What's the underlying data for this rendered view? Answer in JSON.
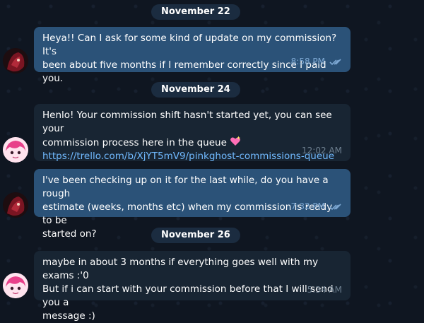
{
  "dates": {
    "d1": "November 22",
    "d2": "November 24",
    "d3": "November 26"
  },
  "messages": [
    {
      "side": "out",
      "text_line1": "Heya!! Can I ask for some kind of update on my commission? It's",
      "text_line2": "been about five months if I remember correctly since I paid you.",
      "time": "8:58 PM"
    },
    {
      "side": "in",
      "text_line1": "Henlo! Your commission shift hasn't started yet, you can see your",
      "text_line2": "commission process here in the queue",
      "link": "https://trello.com/b/XjYT5mV9/pinkghost-commissions-queue",
      "time": "12:02 AM"
    },
    {
      "side": "out",
      "text_line1": "I've been checking up on it for the last while, do you have a rough",
      "text_line2": "estimate (weeks, months etc) when my commission is ready to be",
      "text_line3": "started on?",
      "time": "7:32 PM"
    },
    {
      "side": "in",
      "text_line1": "maybe in about 3 months if everything goes well with my exams :'0",
      "text_line2": "But if i can start with your commission before that I will send you a",
      "text_line3": "message :)",
      "time": "5:34 AM"
    }
  ],
  "icons": {
    "read_receipt": "double-check-icon",
    "sparkle": "sparkling-heart-emoji",
    "avatar_user": "user-avatar-red",
    "avatar_artist": "artist-avatar-pink"
  },
  "colors": {
    "outgoing_bubble": "#2b5278",
    "incoming_bubble": "#182533",
    "date_pill": "#1b2c40",
    "link": "#71baff"
  }
}
